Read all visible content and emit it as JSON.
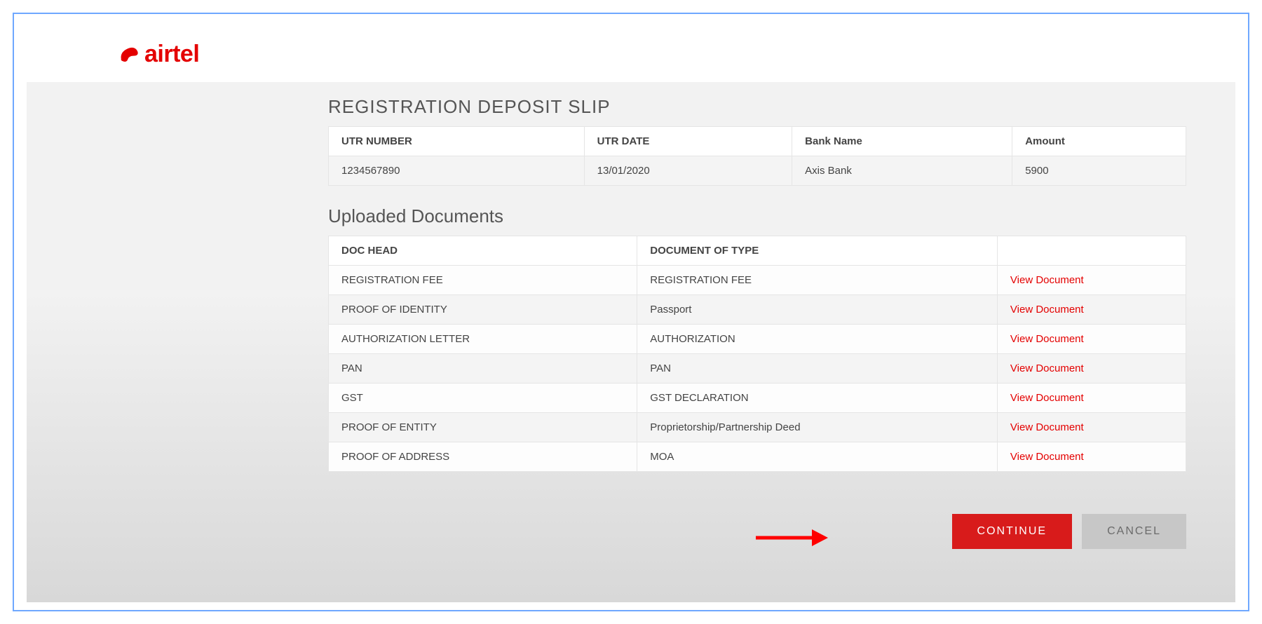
{
  "brand": {
    "name": "airtel"
  },
  "deposit": {
    "title": "REGISTRATION DEPOSIT SLIP",
    "headers": {
      "utr_number": "UTR NUMBER",
      "utr_date": "UTR DATE",
      "bank_name": "Bank Name",
      "amount": "Amount"
    },
    "row": {
      "utr_number": "1234567890",
      "utr_date": "13/01/2020",
      "bank_name": "Axis Bank",
      "amount": "5900"
    }
  },
  "documents": {
    "title": "Uploaded Documents",
    "headers": {
      "doc_head": "DOC HEAD",
      "doc_type": "DOCUMENT OF TYPE",
      "action": ""
    },
    "view_label": "View Document",
    "rows": [
      {
        "head": "REGISTRATION FEE",
        "type": "REGISTRATION FEE"
      },
      {
        "head": "PROOF OF IDENTITY",
        "type": "Passport"
      },
      {
        "head": "AUTHORIZATION LETTER",
        "type": "AUTHORIZATION"
      },
      {
        "head": "PAN",
        "type": "PAN"
      },
      {
        "head": "GST",
        "type": "GST DECLARATION"
      },
      {
        "head": "PROOF OF ENTITY",
        "type": "Proprietorship/Partnership Deed"
      },
      {
        "head": "PROOF OF ADDRESS",
        "type": "MOA"
      }
    ]
  },
  "actions": {
    "continue": "CONTINUE",
    "cancel": "CANCEL"
  }
}
